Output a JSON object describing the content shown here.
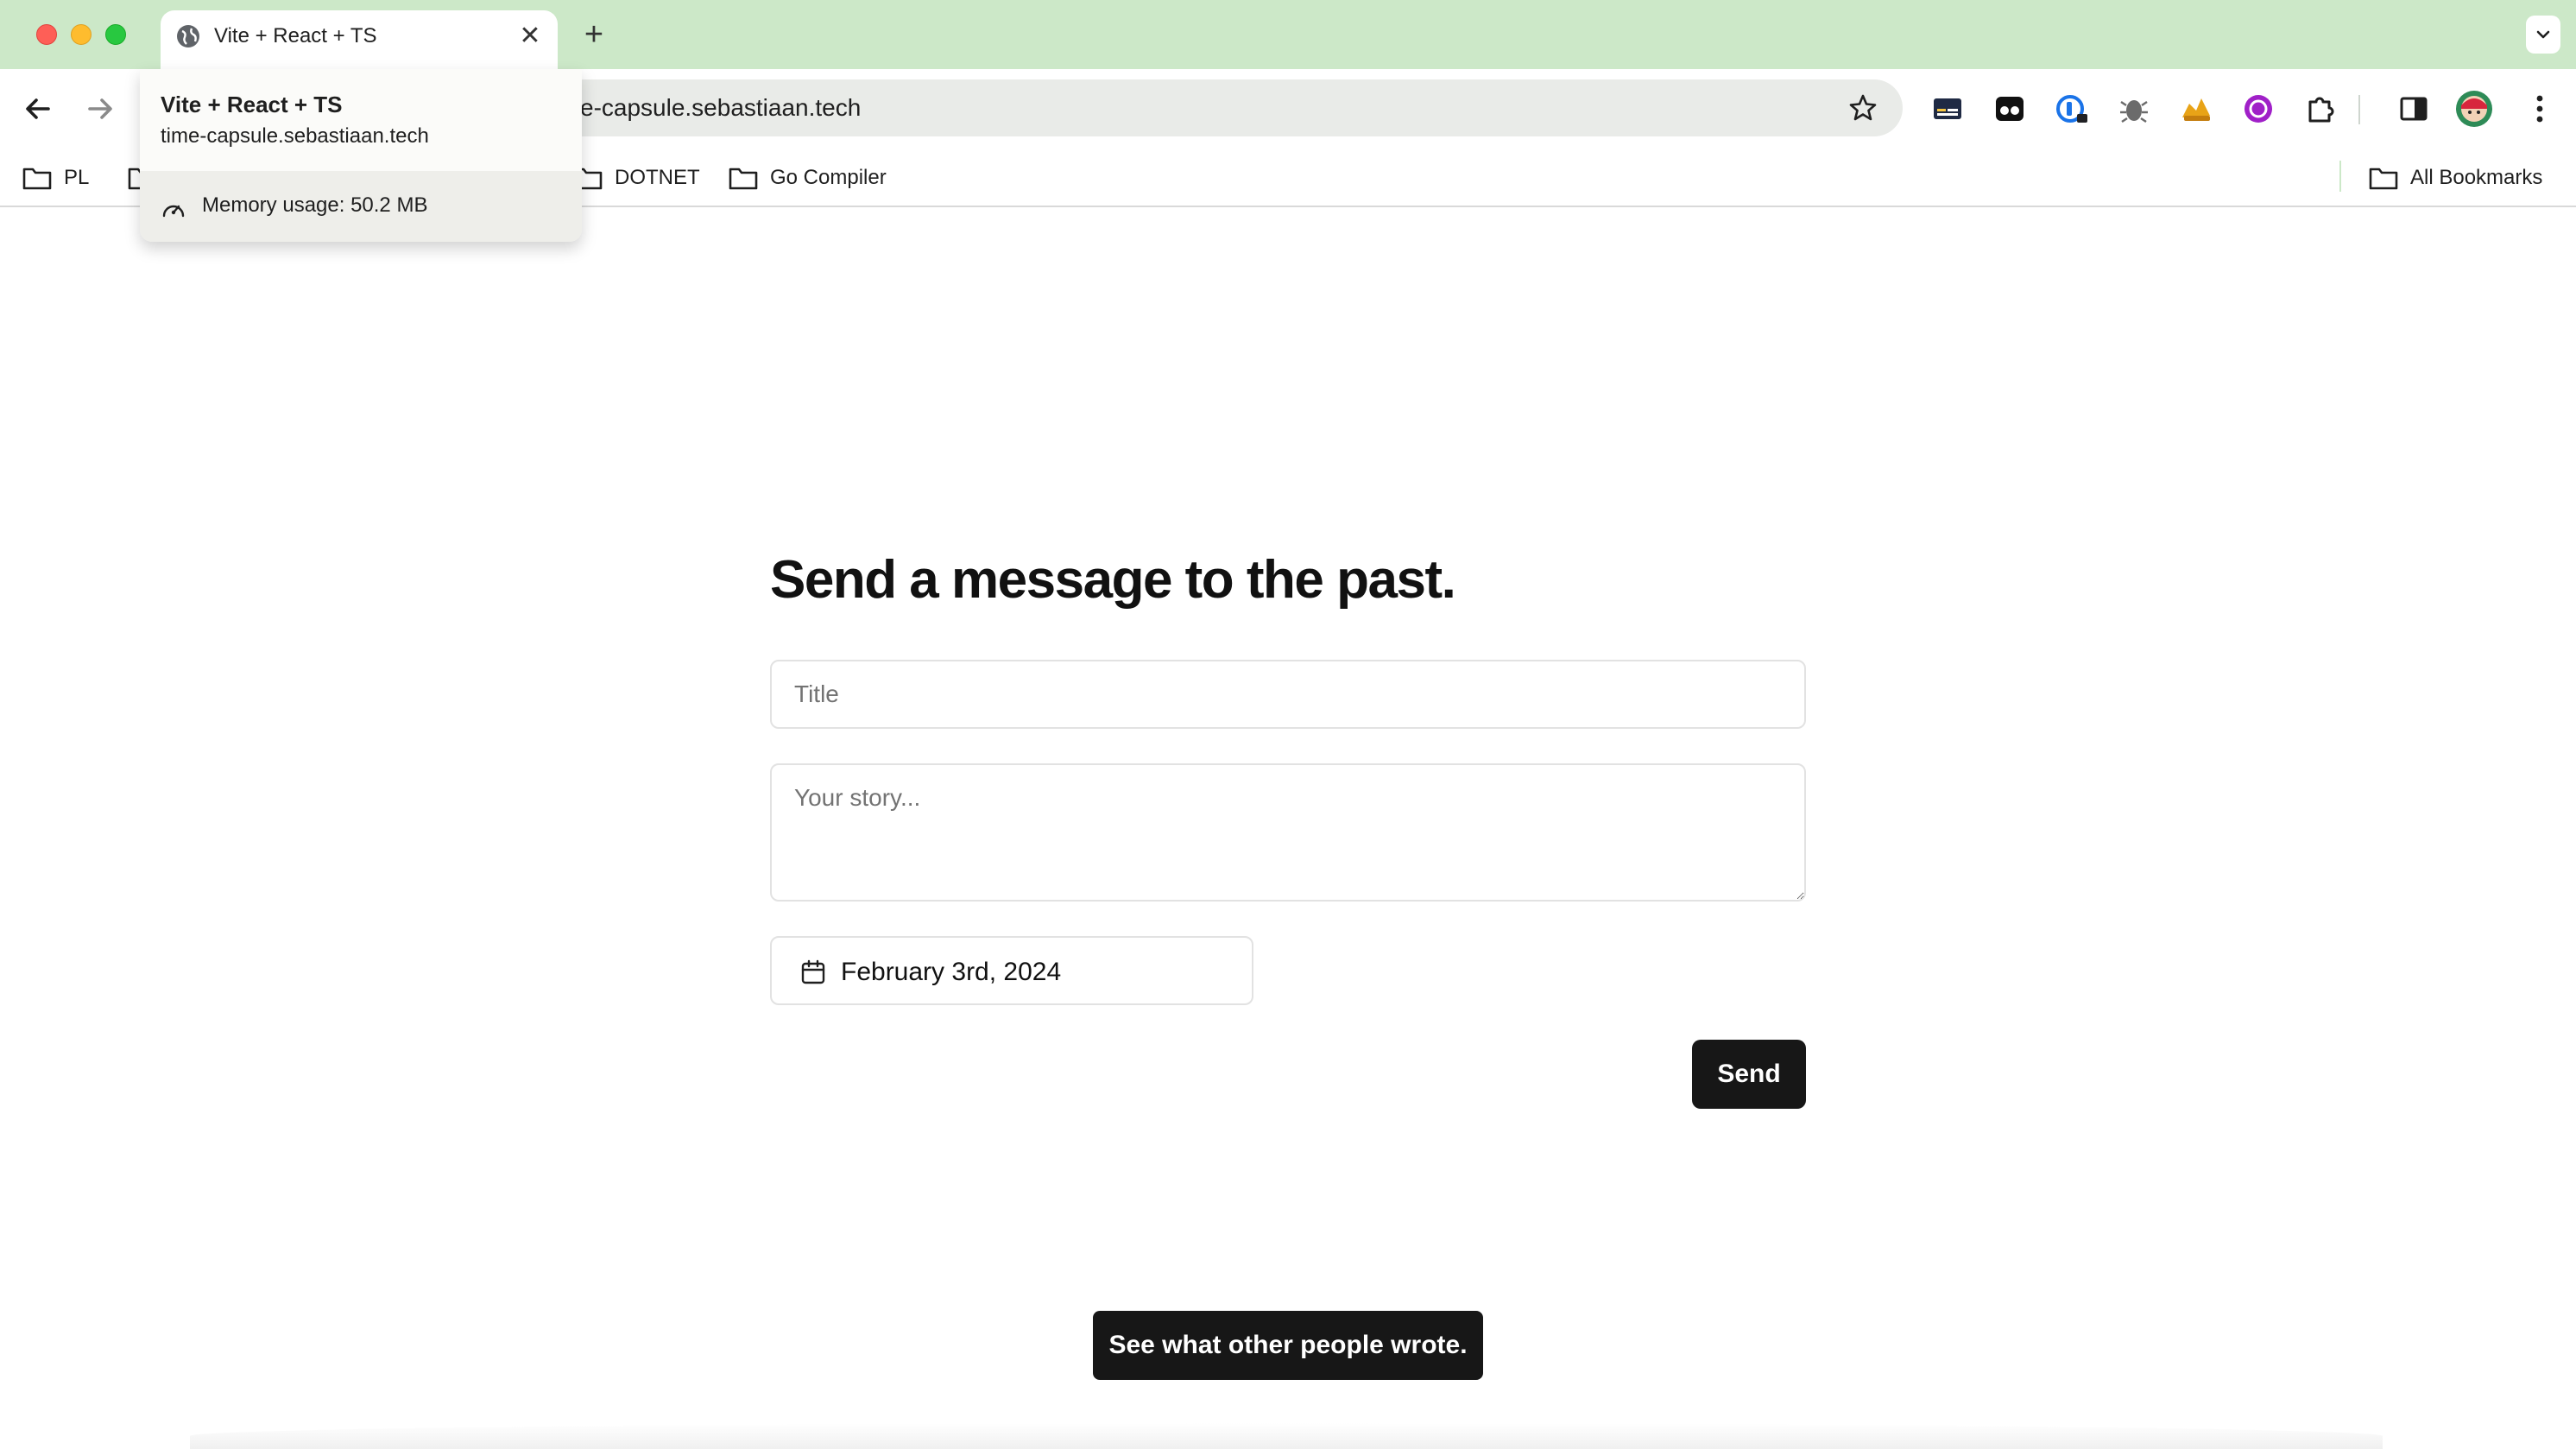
{
  "browser": {
    "tab": {
      "title": "Vite + React + TS",
      "close_glyph": "✕",
      "favicon": "globe-icon"
    },
    "new_tab_glyph": "+",
    "omnibox": {
      "url_visible": "e-capsule.sebastiaan.tech"
    },
    "hovercard": {
      "title": "Vite + React + TS",
      "domain": "time-capsule.sebastiaan.tech",
      "memory": "Memory usage: 50.2 MB"
    },
    "bookmarks": [
      {
        "label": "PL"
      },
      {
        "label": "DOTNET"
      },
      {
        "label": "Go Compiler"
      }
    ],
    "all_bookmarks_label": "All Bookmarks",
    "extensions": [
      "captions-icon",
      "tribe-icon",
      "password-manager-icon",
      "bug-icon",
      "fox-icon",
      "purple-circle-icon",
      "puzzle-icon"
    ]
  },
  "page": {
    "heading": "Send a message to the past.",
    "title_placeholder": "Title",
    "story_placeholder": "Your story...",
    "date_value": "February 3rd, 2024",
    "send_label": "Send",
    "others_label": "See what other people wrote."
  },
  "colors": {
    "tabstrip_bg": "#cce8c8",
    "button_bg": "#171717",
    "omnibox_bg": "#e9ebe8"
  }
}
